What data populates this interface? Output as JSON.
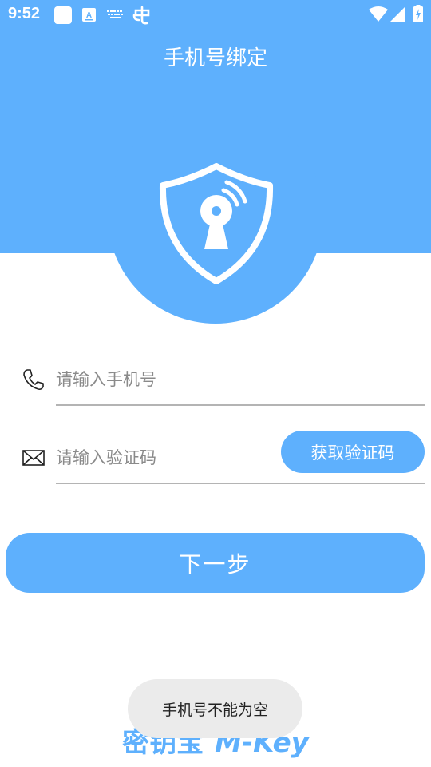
{
  "status_bar": {
    "time": "9:52",
    "left_icons": [
      "app-square-icon",
      "font-a-icon",
      "keyboard-icon",
      "bug-icon"
    ],
    "right_icons": [
      "wifi-icon",
      "cellular-signal-icon",
      "battery-charging-icon"
    ]
  },
  "header": {
    "title": "手机号绑定",
    "logo_icon": "shield-keyhole-signal-icon",
    "color": "#5eb0fd"
  },
  "form": {
    "phone": {
      "icon": "phone-icon",
      "placeholder": "请输入手机号",
      "value": ""
    },
    "code": {
      "icon": "mail-icon",
      "placeholder": "请输入验证码",
      "value": ""
    },
    "get_code_label": "获取验证码"
  },
  "next_button_label": "下一步",
  "brand": {
    "cn": "密钥宝",
    "en": "M-Key"
  },
  "toast": "手机号不能为空",
  "colors": {
    "accent": "#5eb0fd",
    "divider": "#b4b4b4",
    "toast_bg": "#ebebeb"
  }
}
